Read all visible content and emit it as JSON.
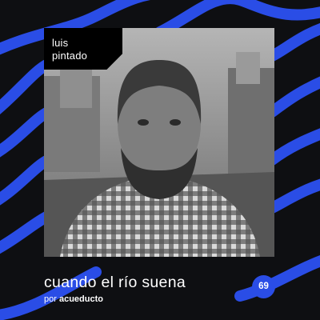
{
  "cover": {
    "host_first": "luis",
    "host_last": "pintado",
    "title": "cuando el río suena",
    "by_prefix": "por",
    "brand": "acueducto",
    "episode": "69"
  },
  "colors": {
    "background": "#0e0f12",
    "accent": "#2a4de6",
    "text": "#ffffff"
  },
  "photo": {
    "description_icon": "portrait-photo"
  }
}
